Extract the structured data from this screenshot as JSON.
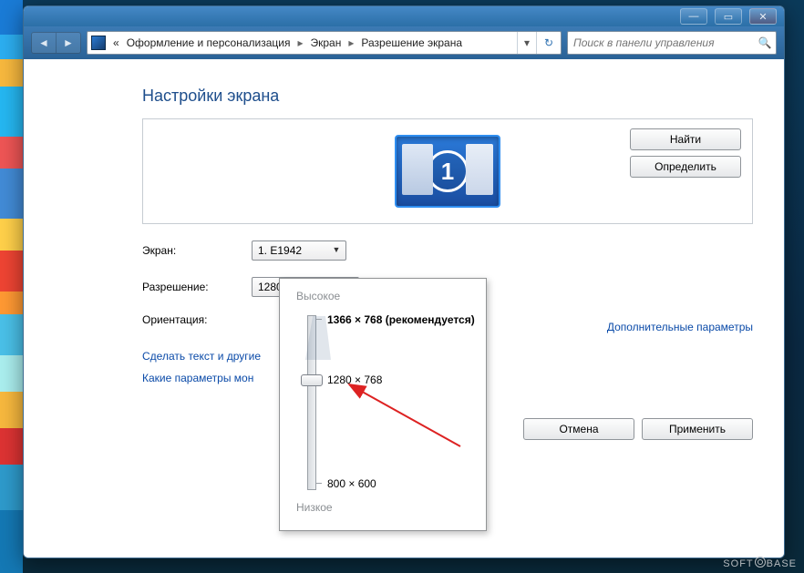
{
  "window": {
    "minimize_glyph": "—",
    "maximize_glyph": "▭",
    "close_glyph": "✕"
  },
  "nav": {
    "back_glyph": "◄",
    "forward_glyph": "►",
    "prefix": "«",
    "crumbs": [
      "Оформление и персонализация",
      "Экран",
      "Разрешение экрана"
    ],
    "sep": "▸",
    "drop_glyph": "▾",
    "refresh_glyph": "↻"
  },
  "search": {
    "placeholder": "Поиск в панели управления",
    "icon": "🔍"
  },
  "page": {
    "title": "Настройки экрана",
    "find_btn": "Найти",
    "detect_btn": "Определить",
    "monitor_number": "1",
    "labels": {
      "screen": "Экран:",
      "resolution": "Разрешение:",
      "orientation": "Ориентация:"
    },
    "screen_value": "1. E1942",
    "resolution_value": "1280 × 768",
    "adv_link": "Дополнительные параметры",
    "link1": "Сделать текст и другие",
    "link2": "Какие параметры мон",
    "cancel": "Отмена",
    "apply": "Применить"
  },
  "popup": {
    "high": "Высокое",
    "low": "Низкое",
    "recommended": "1366 × 768 (рекомендуется)",
    "current": "1280 × 768",
    "min": "800 × 600"
  },
  "watermark": {
    "left": "SOFT",
    "right": "BASE"
  }
}
